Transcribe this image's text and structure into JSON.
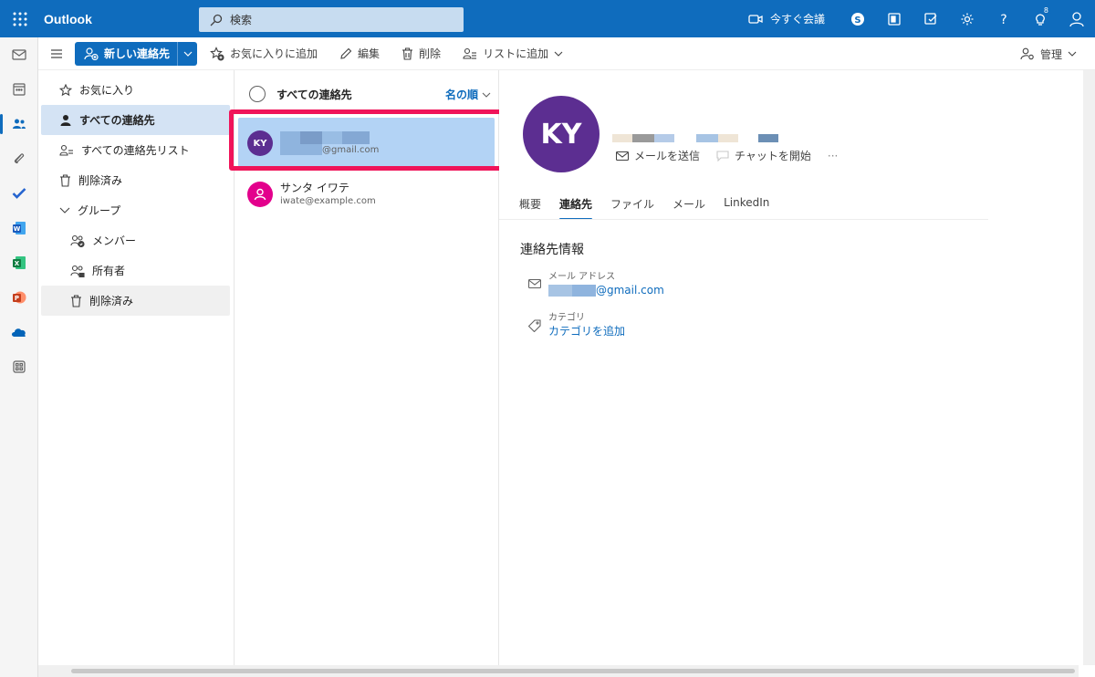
{
  "app": {
    "title": "Outlook"
  },
  "search": {
    "placeholder": "検索"
  },
  "topbar": {
    "meet_label": "今すぐ会議",
    "notification_count": "8"
  },
  "commands": {
    "new_contact": "新しい連絡先",
    "add_favorite": "お気に入りに追加",
    "edit": "編集",
    "delete": "削除",
    "add_to_list": "リストに追加",
    "manage": "管理"
  },
  "folders": {
    "favorites": "お気に入り",
    "all_contacts": "すべての連絡先",
    "all_contact_lists": "すべての連絡先リスト",
    "deleted": "削除済み",
    "groups": "グループ",
    "members": "メンバー",
    "owners": "所有者",
    "group_deleted": "削除済み"
  },
  "list": {
    "header": "すべての連絡先",
    "sort": "名の順",
    "contacts": [
      {
        "initials": "KY",
        "email_suffix": "@gmail.com",
        "color": "#5c2e91"
      },
      {
        "name": "サンタ イワテ",
        "email": "iwate@example.com",
        "color": "#e3008c"
      }
    ]
  },
  "detail": {
    "initials": "KY",
    "send_email": "メールを送信",
    "start_chat": "チャットを開始",
    "more": "···",
    "tabs": [
      "概要",
      "連絡先",
      "ファイル",
      "メール",
      "LinkedIn"
    ],
    "section_title": "連絡先情報",
    "email_label": "メール アドレス",
    "email_suffix": "@gmail.com",
    "category_label": "カテゴリ",
    "category_link": "カテゴリを追加"
  },
  "colors": {
    "accent": "#0f6cbd",
    "highlight": "#f0145a",
    "avatar_purple": "#5c2e91",
    "avatar_pink": "#e3008c"
  }
}
